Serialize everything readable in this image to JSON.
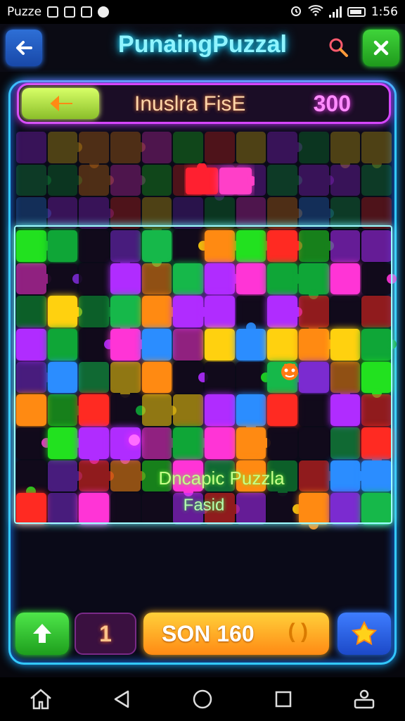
{
  "status_bar": {
    "app_label": "Puzze",
    "time": "1:56"
  },
  "header": {
    "title": "PunaingPuzzal"
  },
  "level_bar": {
    "name": "Inuslra FisE",
    "score": "300"
  },
  "board": {
    "text_line_1": "Dncapic Puzzla",
    "text_line_2": "Fasid"
  },
  "controls": {
    "count": "1",
    "score_label": "SON 160",
    "score_suffix": "( )"
  },
  "colors": {
    "frame": "#33c9ff",
    "level_border": "#d646ff",
    "title_glow": "#25e4ff",
    "accent_orange": "#ff8a14"
  },
  "icons": {
    "back": "arrow-left-icon",
    "close": "close-icon",
    "search": "search-icon",
    "up": "arrow-up-icon",
    "star": "star-icon",
    "home": "home-icon",
    "nav_back": "triangle-back-icon",
    "nav_home": "circle-home-icon",
    "recents": "square-recents-icon",
    "user": "user-icon"
  }
}
